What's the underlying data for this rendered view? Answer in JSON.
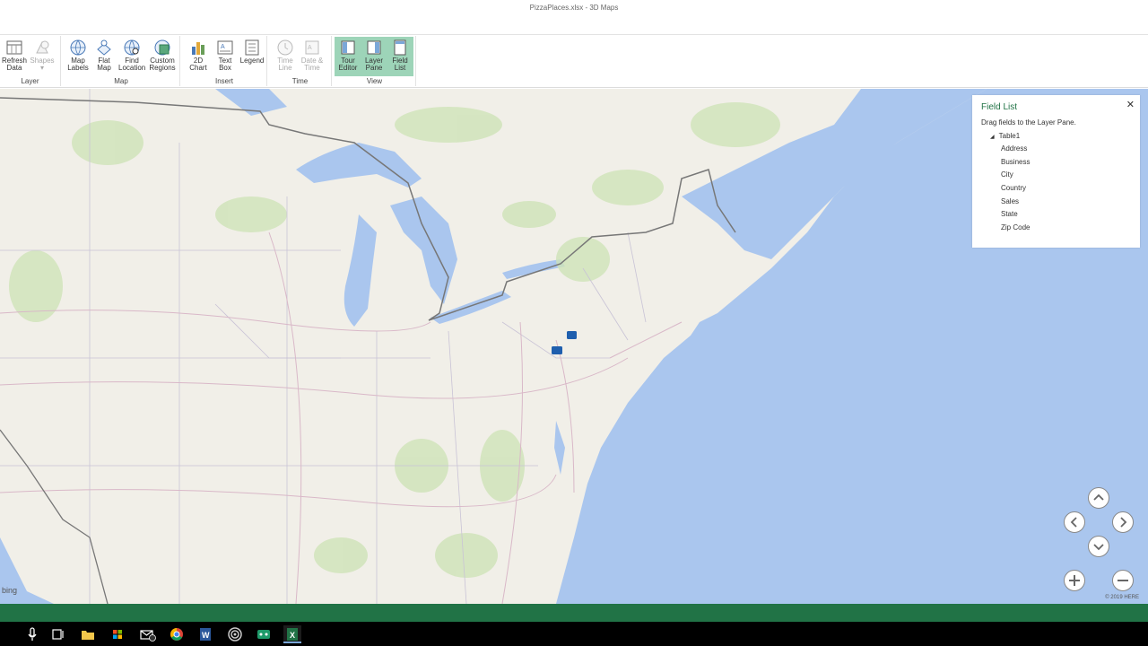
{
  "window": {
    "title": "PizzaPlaces.xlsx - 3D Maps"
  },
  "ribbon": {
    "groups": {
      "layer": "Layer",
      "map": "Map",
      "insert": "Insert",
      "time": "Time",
      "view": "View"
    },
    "buttons": {
      "refresh_data": [
        "Refresh",
        "Data"
      ],
      "shapes": [
        "Shapes",
        "▾"
      ],
      "map_labels": [
        "Map",
        "Labels"
      ],
      "flat_map": [
        "Flat",
        "Map"
      ],
      "find_location": [
        "Find",
        "Location"
      ],
      "custom_regions": [
        "Custom",
        "Regions"
      ],
      "chart_2d": [
        "2D",
        "Chart"
      ],
      "text_box": [
        "Text",
        "Box"
      ],
      "legend": [
        "Legend",
        ""
      ],
      "time_line": [
        "Time",
        "Line"
      ],
      "date_time": [
        "Date &",
        "Time"
      ],
      "tour_editor": [
        "Tour",
        "Editor"
      ],
      "layer_pane": [
        "Layer",
        "Pane"
      ],
      "field_list": [
        "Field",
        "List"
      ]
    }
  },
  "field_list": {
    "title": "Field List",
    "close": "✕",
    "instruction": "Drag fields to the Layer Pane.",
    "table_name": "Table1",
    "fields": [
      "Address",
      "Business",
      "City",
      "Country",
      "Sales",
      "State",
      "Zip Code"
    ]
  },
  "map": {
    "provider": "bing",
    "copyright": "© 2019 HERE",
    "data_point_color": "#1f5fae",
    "colors": {
      "water": "#aac6ee",
      "land": "#f1efe8",
      "border": "#666666",
      "accent": "#217346"
    }
  }
}
